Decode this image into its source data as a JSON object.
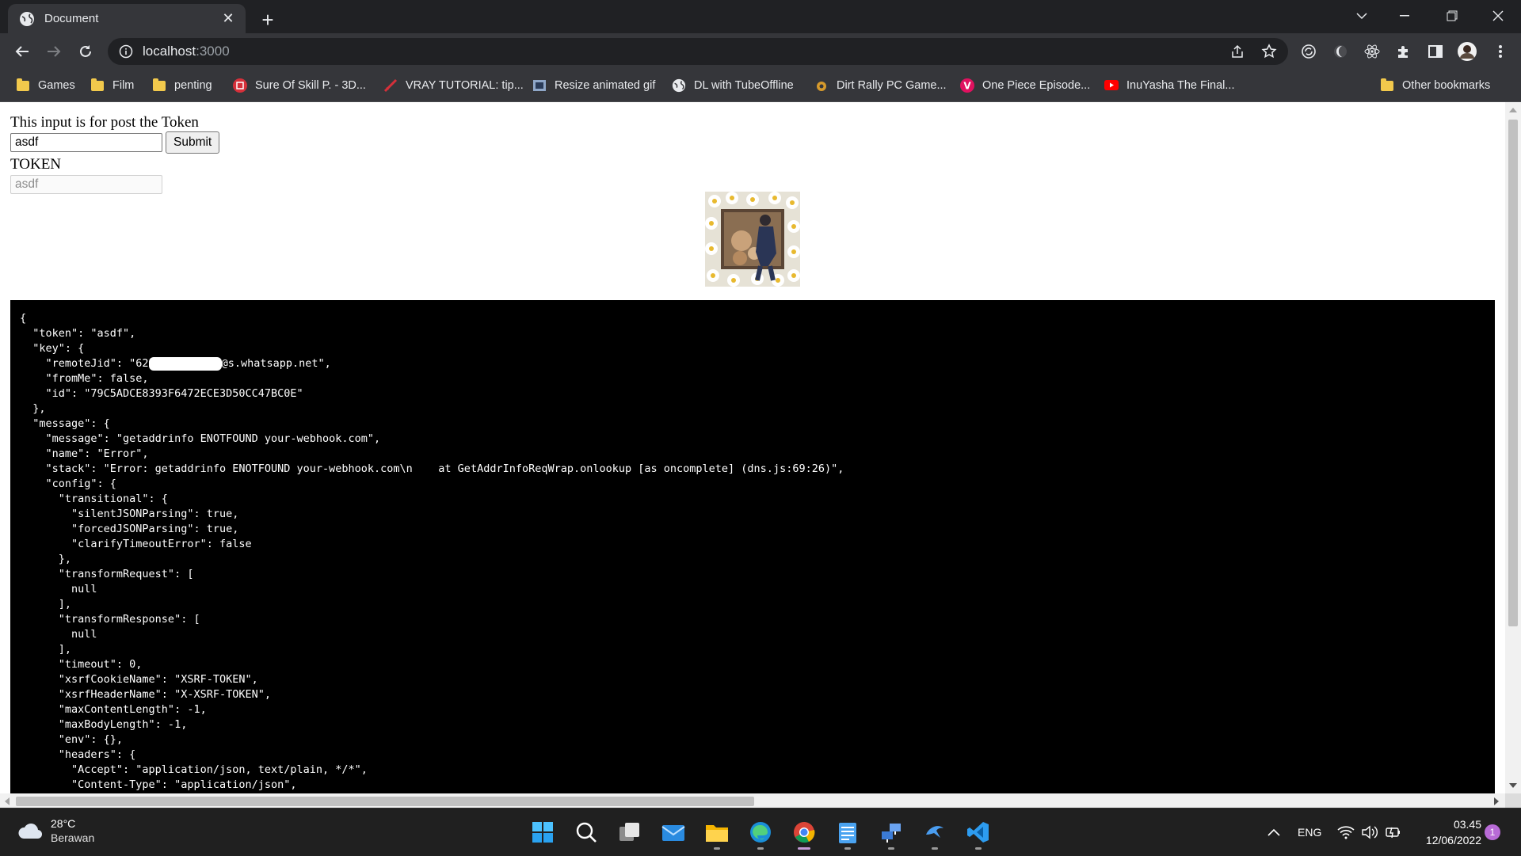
{
  "browser": {
    "tab_title": "Document",
    "url_host": "localhost",
    "url_port": ":3000",
    "bookmarks": [
      {
        "label": "Games",
        "icon": "folder-icon"
      },
      {
        "label": "Film",
        "icon": "folder-icon"
      },
      {
        "label": "penting",
        "icon": "folder-icon"
      },
      {
        "label": "Sure Of Skill P. - 3D...",
        "icon": "site-icon"
      },
      {
        "label": "VRAY TUTORIAL: tip...",
        "icon": "site-icon"
      },
      {
        "label": "Resize animated gif",
        "icon": "site-icon"
      },
      {
        "label": "DL with TubeOffline",
        "icon": "globe-icon"
      },
      {
        "label": "Dirt Rally PC Game...",
        "icon": "site-icon"
      },
      {
        "label": "One Piece Episode...",
        "icon": "site-icon"
      },
      {
        "label": "InuYasha The Final...",
        "icon": "youtube-icon"
      }
    ],
    "other_bookmarks": "Other bookmarks"
  },
  "page": {
    "post_label": "This input is for post the Token",
    "token_input_value": "asdf",
    "submit_label": "Submit",
    "token_heading": "TOKEN",
    "token_display_value": "asdf"
  },
  "console": {
    "lines_before_redaction": "{\n  \"token\": \"asdf\",\n  \"key\": {\n    \"remoteJid\": \"62",
    "redaction_suffix": "@s.whatsapp.net\",",
    "lines_after_redaction": "\n    \"fromMe\": false,\n    \"id\": \"79C5ADCE8393F6472ECE3D50CC47BC0E\"\n  },\n  \"message\": {\n    \"message\": \"getaddrinfo ENOTFOUND your-webhook.com\",\n    \"name\": \"Error\",\n    \"stack\": \"Error: getaddrinfo ENOTFOUND your-webhook.com\\n    at GetAddrInfoReqWrap.onlookup [as oncomplete] (dns.js:69:26)\",\n    \"config\": {\n      \"transitional\": {\n        \"silentJSONParsing\": true,\n        \"forcedJSONParsing\": true,\n        \"clarifyTimeoutError\": false\n      },\n      \"transformRequest\": [\n        null\n      ],\n      \"transformResponse\": [\n        null\n      ],\n      \"timeout\": 0,\n      \"xsrfCookieName\": \"XSRF-TOKEN\",\n      \"xsrfHeaderName\": \"X-XSRF-TOKEN\",\n      \"maxContentLength\": -1,\n      \"maxBodyLength\": -1,\n      \"env\": {},\n      \"headers\": {\n        \"Accept\": \"application/json, text/plain, */*\",\n        \"Content-Type\": \"application/json\","
  },
  "taskbar": {
    "temperature": "28°C",
    "condition": "Berawan",
    "language": "ENG",
    "time": "03.45",
    "date": "12/06/2022",
    "notification_count": "1"
  }
}
